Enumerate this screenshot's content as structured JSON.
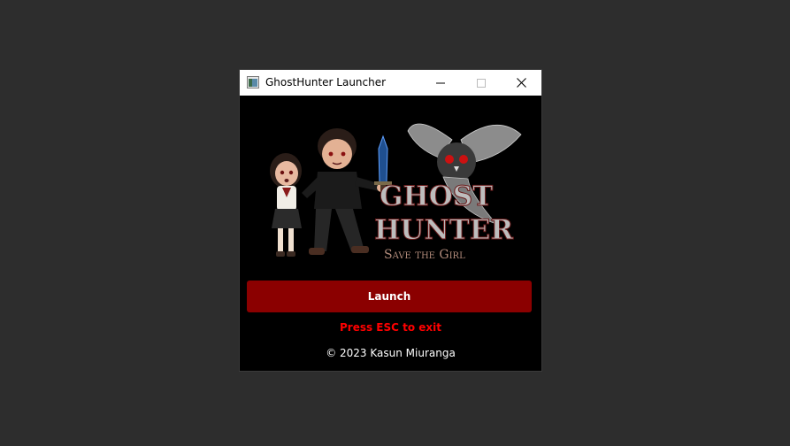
{
  "window": {
    "title": "GhostHunter Launcher"
  },
  "artwork": {
    "logo_line1": "GHOST",
    "logo_line2": "HUNTER",
    "logo_subtitle": "Save the Girl"
  },
  "actions": {
    "launch_label": "Launch"
  },
  "footer": {
    "hint": "Press ESC to exit",
    "copyright": "© 2023 Kasun Miuranga"
  },
  "colors": {
    "desktop_bg": "#2d2d2d",
    "window_bg": "#000000",
    "launch_button_bg": "#8b0000",
    "hint_text": "#ff0000"
  }
}
